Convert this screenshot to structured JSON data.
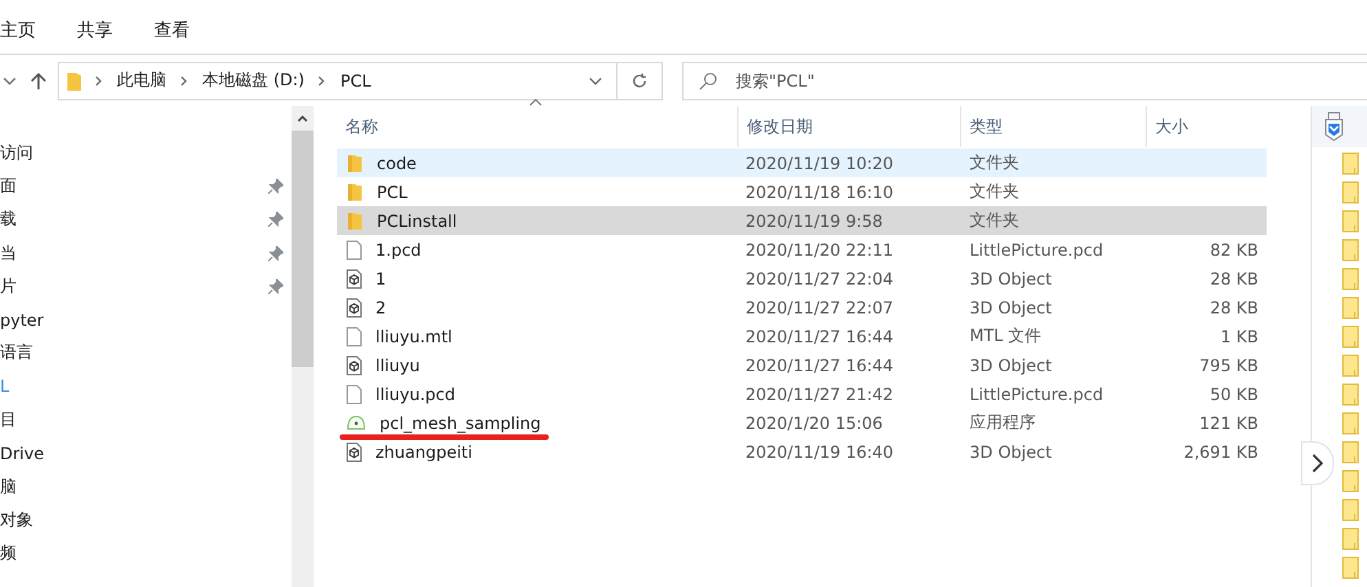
{
  "ribbon_tabs": [
    {
      "label": "主页"
    },
    {
      "label": "共享"
    },
    {
      "label": "查看"
    }
  ],
  "address": {
    "crumbs": [
      "此电脑",
      "本地磁盘 (D:)",
      "PCL"
    ]
  },
  "search": {
    "placeholder": "搜索\"PCL\""
  },
  "sidebar": {
    "items": [
      {
        "label": "访问",
        "pinned": false,
        "selected": false
      },
      {
        "label": "面",
        "pinned": true,
        "selected": false
      },
      {
        "label": "载",
        "pinned": true,
        "selected": false
      },
      {
        "label": "当",
        "pinned": true,
        "selected": false
      },
      {
        "label": "片",
        "pinned": true,
        "selected": false
      },
      {
        "label": "pyter",
        "pinned": false,
        "selected": false
      },
      {
        "label": "语言",
        "pinned": false,
        "selected": false
      },
      {
        "label": "L",
        "pinned": false,
        "selected": true
      },
      {
        "label": "目",
        "pinned": false,
        "selected": false
      },
      {
        "label": "Drive",
        "pinned": false,
        "selected": false
      },
      {
        "label": "脑",
        "pinned": false,
        "selected": false
      },
      {
        "label": "对象",
        "pinned": false,
        "selected": false
      },
      {
        "label": "频",
        "pinned": false,
        "selected": false
      }
    ]
  },
  "table": {
    "columns": [
      "名称",
      "修改日期",
      "类型",
      "大小"
    ],
    "rows": [
      {
        "kind": "folder",
        "name": "code",
        "date": "2020/11/19 10:20",
        "type": "文件夹",
        "selected": true,
        "hovered": false,
        "marked": false
      },
      {
        "kind": "folder",
        "name": "PCL",
        "date": "2020/11/18 16:10",
        "type": "文件夹",
        "selected": false,
        "hovered": false,
        "marked": false
      },
      {
        "kind": "folder",
        "name": "PCLinstall",
        "date": "2020/11/19 9:58",
        "type": "文件夹",
        "selected": false,
        "hovered": true,
        "marked": false
      },
      {
        "kind": "file",
        "name": "1.pcd",
        "date": "2020/11/20 22:11",
        "type": "LittlePicture.pcd",
        "size": "82 KB",
        "selected": false,
        "hovered": false,
        "marked": false
      },
      {
        "kind": "object",
        "name": "1",
        "date": "2020/11/27 22:04",
        "type": "3D Object",
        "size": "28 KB",
        "selected": false,
        "hovered": false,
        "marked": false
      },
      {
        "kind": "object",
        "name": "2",
        "date": "2020/11/27 22:07",
        "type": "3D Object",
        "size": "28 KB",
        "selected": false,
        "hovered": false,
        "marked": false
      },
      {
        "kind": "file",
        "name": "lliuyu.mtl",
        "date": "2020/11/27 16:44",
        "type": "MTL 文件",
        "size": "1 KB",
        "selected": false,
        "hovered": false,
        "marked": false
      },
      {
        "kind": "object",
        "name": "lliuyu",
        "date": "2020/11/27 16:44",
        "type": "3D Object",
        "size": "795 KB",
        "selected": false,
        "hovered": false,
        "marked": false
      },
      {
        "kind": "file",
        "name": "lliuyu.pcd",
        "date": "2020/11/27 21:42",
        "type": "LittlePicture.pcd",
        "size": "50 KB",
        "selected": false,
        "hovered": false,
        "marked": false
      },
      {
        "kind": "app",
        "name": "pcl_mesh_sampling",
        "date": "2020/1/20 15:06",
        "type": "应用程序",
        "size": "121 KB",
        "selected": false,
        "hovered": false,
        "marked": true
      },
      {
        "kind": "object",
        "name": "zhuangpeiti",
        "date": "2020/11/19 16:40",
        "type": "3D Object",
        "size": "2,691 KB",
        "selected": false,
        "hovered": false,
        "marked": false
      }
    ]
  }
}
